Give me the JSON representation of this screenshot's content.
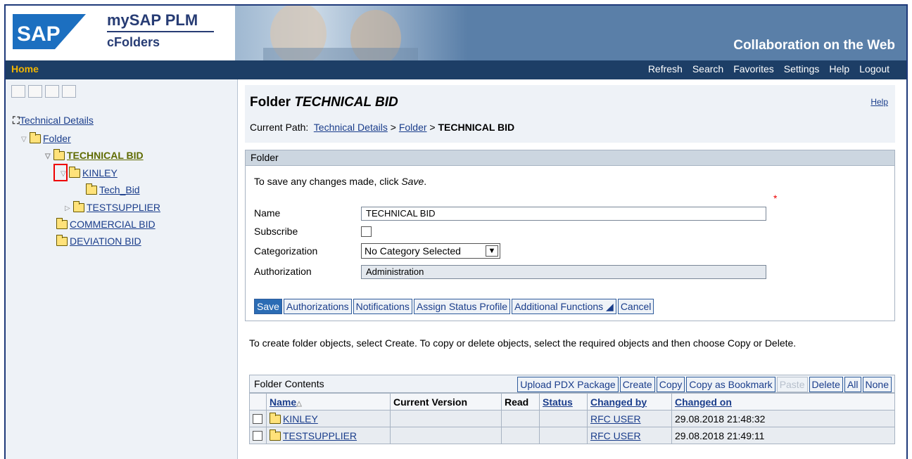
{
  "header": {
    "product_line1": "mySAP PLM",
    "product_line2": "cFolders",
    "tagline": "Collaboration on the Web"
  },
  "menubar": {
    "home": "Home",
    "items": [
      "Refresh",
      "Search",
      "Favorites",
      "Settings",
      "Help",
      "Logout"
    ]
  },
  "sidebar": {
    "root": "Technical Details",
    "folder": "Folder",
    "technical_bid": "TECHNICAL BID",
    "kinley": "KINLEY",
    "tech_bid": "Tech_Bid",
    "testsupplier": "TESTSUPPLIER",
    "commercial_bid": "COMMERCIAL BID",
    "deviation_bid": "DEVIATION BID"
  },
  "main": {
    "title_prefix": "Folder",
    "title_name": "TECHNICAL BID",
    "help": "Help",
    "path_label": "Current Path:",
    "path_link1": "Technical Details",
    "path_sep1": ">",
    "path_link2": "Folder",
    "path_sep2": ">",
    "path_current": "TECHNICAL BID",
    "panel_title": "Folder",
    "hint_text": "To save any changes made, click ",
    "hint_em": "Save",
    "hint_end": ".",
    "name_label": "Name",
    "name_value": "TECHNICAL BID",
    "required_mark": "*",
    "subscribe_label": "Subscribe",
    "categorization_label": "Categorization",
    "categorization_value": "No Category Selected",
    "authorization_label": "Authorization",
    "authorization_value": "Administration",
    "buttons": [
      "Save",
      "Authorizations",
      "Notifications",
      "Assign Status Profile",
      "Additional Functions ◢",
      "Cancel"
    ],
    "info_text": "To create folder objects, select Create. To copy or delete objects, select the required objects and then choose Copy or Delete."
  },
  "contents": {
    "title": "Folder Contents",
    "buttons": [
      "Upload PDX Package",
      "Create",
      "Copy",
      "Copy as Bookmark",
      "Paste",
      "Delete",
      "All",
      "None"
    ],
    "columns": [
      "Name",
      "Current Version",
      "Read",
      "Status",
      "Changed by",
      "Changed on"
    ],
    "rows": [
      {
        "name": "KINLEY",
        "changed_by": "RFC USER",
        "changed_on": "29.08.2018 21:48:32"
      },
      {
        "name": "TESTSUPPLIER",
        "changed_by": "RFC USER",
        "changed_on": "29.08.2018 21:49:11"
      }
    ]
  },
  "colors": {
    "banner": "#5a7fa8",
    "menubar": "#1d3e66",
    "home_accent": "#f0b400",
    "link": "#1a3d8b",
    "primary_button": "#2b6cb4"
  }
}
